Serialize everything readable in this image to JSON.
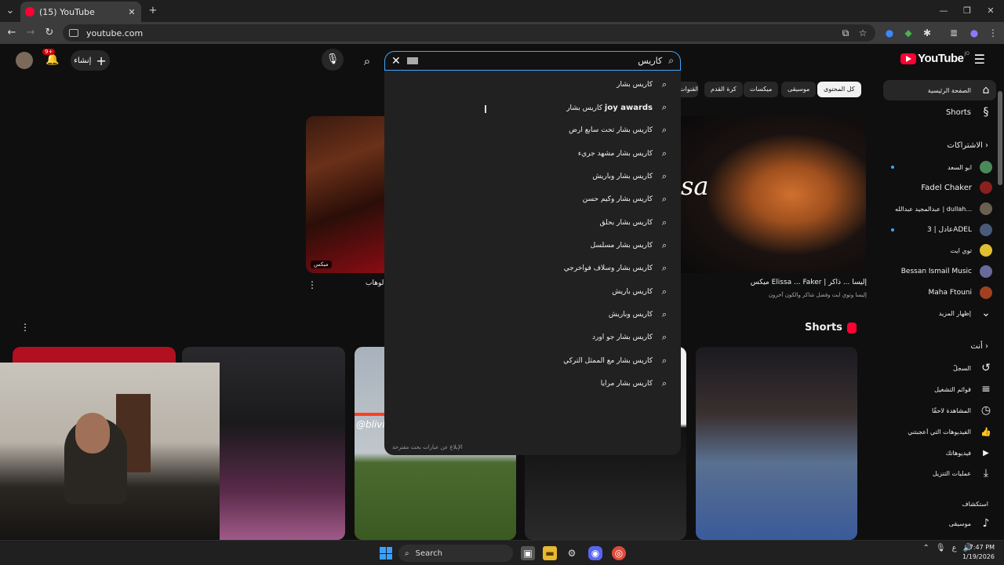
{
  "browser": {
    "tab_title": "(15) YouTube",
    "url": "youtube.com",
    "new_tab": "+",
    "close": "✕"
  },
  "header": {
    "logo_text": "YouTube",
    "logo_sup": "JO",
    "search_query": "كاريس",
    "create_label": "إنشاء",
    "notifications_badge": "9+"
  },
  "chips": [
    {
      "label": "كل المحتوى",
      "active": true
    },
    {
      "label": "موسيقى"
    },
    {
      "label": "ميكسات"
    },
    {
      "label": "كرة القدم"
    },
    {
      "label": "القنوات"
    }
  ],
  "suggestions": [
    {
      "text": "كاريس بشار",
      "bold": ""
    },
    {
      "text": "كاريس بشار ",
      "bold": "joy awards"
    },
    {
      "text": "كاريس بشار تحت سابع ارض",
      "bold": ""
    },
    {
      "text": "كاريس بشار مشهد جريء",
      "bold": ""
    },
    {
      "text": "كاريس بشار وباريش",
      "bold": ""
    },
    {
      "text": "كاريس بشار وكيم حسن",
      "bold": ""
    },
    {
      "text": "كاريس بشار بحلق",
      "bold": ""
    },
    {
      "text": "كاريس بشار مسلسل",
      "bold": ""
    },
    {
      "text": "كاريس بشار وسلاف فواخرجي",
      "bold": ""
    },
    {
      "text": "كاريس باريش",
      "bold": ""
    },
    {
      "text": "كاريس وباريش",
      "bold": ""
    },
    {
      "text": "كاريس بشار جو اورد",
      "bold": ""
    },
    {
      "text": "كاريس بشار مع الممثل التركي",
      "bold": ""
    },
    {
      "text": "كاريس بشار مرايا",
      "bold": ""
    }
  ],
  "report_text": "الإبلاغ عن عبارات بحث مقترحة",
  "videos": {
    "left_badge": "ميكس",
    "left_title": "الوهاب",
    "right_overlay": "sa",
    "right_title": "ميكس Elissa ... Faker | إليسا ... ذاكر",
    "right_meta": "إليسا وتوي ايت وفضل شاكر والكون آخرون"
  },
  "shorts": {
    "heading": "Shorts",
    "tag": "@blivixidy"
  },
  "sidebar": {
    "home": "الصفحة الرئيسية",
    "shorts": "Shorts",
    "subscriptions": "الاشتراكات",
    "subs": [
      {
        "name": "ابو السعد",
        "dot": true,
        "color": "#4a8a5a"
      },
      {
        "name": "Fadel Chaker",
        "dot": false,
        "color": "#8a2020"
      },
      {
        "name": "عبدالمجيد عبدالله | dullah...",
        "dot": false,
        "color": "#6a6050"
      },
      {
        "name": "عادل | 3ADEL",
        "dot": true,
        "color": "#4a5a7a"
      },
      {
        "name": "توي ايت",
        "dot": false,
        "color": "#e0c030"
      },
      {
        "name": "Bessan Ismail Music",
        "dot": false,
        "color": "#6a6a9a"
      },
      {
        "name": "Maha Ftouni",
        "dot": false,
        "color": "#a04020"
      }
    ],
    "show_more": "إظهار المزيد",
    "you": "أنت",
    "you_items": [
      {
        "label": "السجلّ",
        "icon": "history-icon",
        "glyph": "↺"
      },
      {
        "label": "قوائم التشغيل",
        "icon": "playlists-icon",
        "glyph": "≡"
      },
      {
        "label": "المشاهدة لاحقًا",
        "icon": "watch-later-icon",
        "glyph": "◷"
      },
      {
        "label": "الفيديوهات التي أعجبتني",
        "icon": "like-icon",
        "glyph": "👍"
      },
      {
        "label": "فيديوهاتك",
        "icon": "your-videos-icon",
        "glyph": "▶"
      },
      {
        "label": "عمليات التنزيل",
        "icon": "download-icon",
        "glyph": "⤓"
      }
    ],
    "explore": "استكشاف",
    "music": "موسيقى"
  },
  "taskbar": {
    "search": "Search",
    "time": "7:47 PM",
    "date": "1/19/2026",
    "lang": "ع"
  }
}
